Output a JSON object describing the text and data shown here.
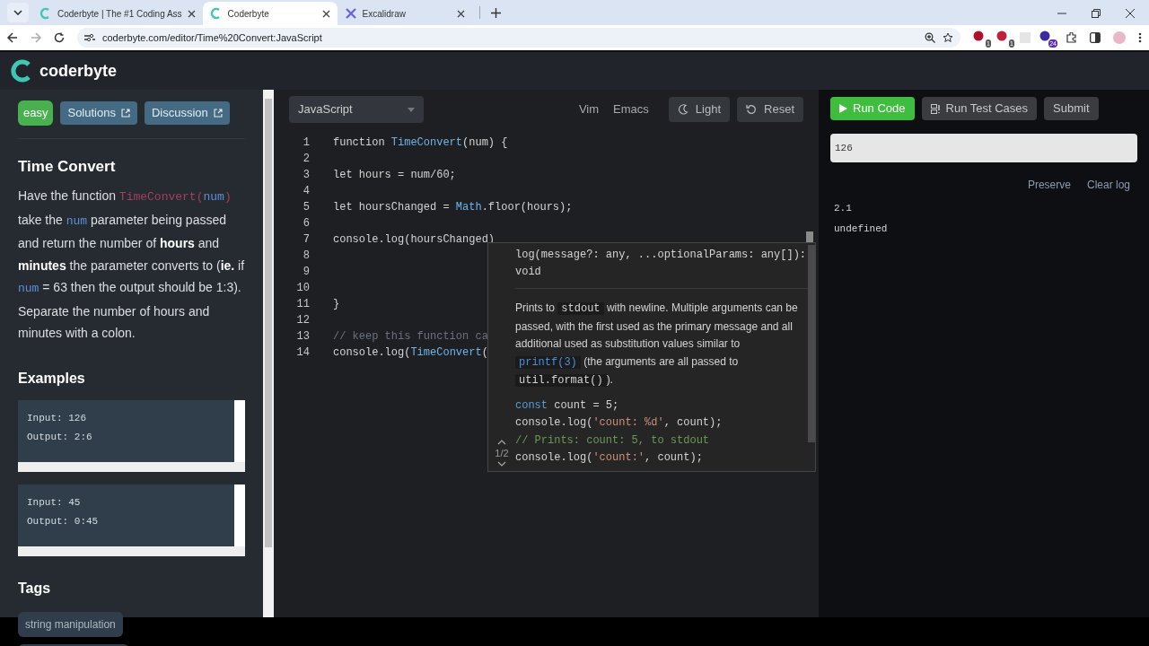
{
  "browser": {
    "tabs": [
      {
        "title": "Coderbyte | The #1 Coding Ass",
        "selected": false
      },
      {
        "title": "Coderbyte",
        "selected": true
      },
      {
        "title": "Excalidraw",
        "selected": false
      }
    ],
    "address": "coderbyte.com/editor/Time%20Convert:JavaScript",
    "extension_badges": [
      "1",
      "1",
      "24"
    ]
  },
  "header": {
    "logo": "coderbyte"
  },
  "problem": {
    "difficulty": "easy",
    "links": [
      "Solutions",
      "Discussion"
    ],
    "title": "Time Convert",
    "description": [
      {
        "kind": "text",
        "text": "Have the function "
      },
      {
        "kind": "code_fn",
        "text": "TimeConvert"
      },
      {
        "kind": "code_punct",
        "text": "("
      },
      {
        "kind": "code",
        "text": "num"
      },
      {
        "kind": "code_punct",
        "text": ")"
      },
      {
        "kind": "text",
        "text": " take the "
      },
      {
        "kind": "code",
        "text": "num"
      },
      {
        "kind": "text",
        "text": " parameter being passed and return the number of "
      },
      {
        "kind": "bold",
        "text": "hours"
      },
      {
        "kind": "text",
        "text": " and "
      },
      {
        "kind": "bold",
        "text": "minutes"
      },
      {
        "kind": "text",
        "text": " the parameter converts to ("
      },
      {
        "kind": "bold",
        "text": "ie."
      },
      {
        "kind": "text",
        "text": " if "
      },
      {
        "kind": "code",
        "text": "num"
      },
      {
        "kind": "text",
        "text": " = 63 then the output should be 1:3). Separate the number of hours and minutes with a colon."
      }
    ],
    "examples_heading": "Examples",
    "examples": [
      {
        "lines": [
          "Input: 126",
          "Output: 2:6"
        ]
      },
      {
        "lines": [
          "Input: 45",
          "Output: 0:45"
        ]
      }
    ],
    "tags_heading": "Tags",
    "tags": [
      "string manipulation"
    ]
  },
  "editor": {
    "language": "JavaScript",
    "modes": [
      "Vim",
      "Emacs"
    ],
    "buttons": [
      {
        "kind": "theme",
        "label": "Light"
      },
      {
        "kind": "reset",
        "label": "Reset"
      }
    ],
    "lines": [
      {
        "number": "1",
        "tokens": [
          {
            "kind": "plain",
            "text": "function "
          },
          {
            "kind": "fn",
            "text": "TimeConvert"
          },
          {
            "kind": "plain",
            "text": "(num) {"
          }
        ]
      },
      {
        "number": "2"
      },
      {
        "number": "3",
        "tokens": [
          {
            "kind": "plain",
            "text": "let hours = num/60;"
          }
        ]
      },
      {
        "number": "4"
      },
      {
        "number": "5",
        "tokens": [
          {
            "kind": "plain",
            "text": "let hoursChanged = "
          },
          {
            "kind": "fn",
            "text": "Math"
          },
          {
            "kind": "plain",
            "text": ".floor(hours);"
          }
        ]
      },
      {
        "number": "6"
      },
      {
        "number": "7",
        "tokens": [
          {
            "kind": "plain",
            "text": "console.log(hoursChanged)"
          }
        ]
      },
      {
        "number": "8"
      },
      {
        "number": "9"
      },
      {
        "number": "10"
      },
      {
        "number": "11",
        "tokens": [
          {
            "kind": "plain",
            "text": "}"
          }
        ]
      },
      {
        "number": "12"
      },
      {
        "number": "13",
        "tokens": [
          {
            "kind": "comment",
            "text": "// keep this function ca"
          }
        ]
      },
      {
        "number": "14",
        "tokens": [
          {
            "kind": "plain",
            "text": "console.log("
          },
          {
            "kind": "fn",
            "text": "TimeConvert"
          },
          {
            "kind": "plain",
            "text": "("
          }
        ]
      }
    ],
    "hover": {
      "signature": "log(message?: any, ...optionalParams: any[]): void",
      "description": [
        {
          "kind": "text",
          "text": "Prints to "
        },
        {
          "kind": "code",
          "text": "stdout"
        },
        {
          "kind": "text",
          "text": " with newline. Multiple arguments can be passed, with the first used as the primary message and all additional used as substitution values similar to "
        },
        {
          "kind": "link",
          "text": "printf(3)"
        },
        {
          "kind": "text",
          "text": " (the arguments are all passed to "
        },
        {
          "kind": "code",
          "text": "util.format()"
        },
        {
          "kind": "text",
          "text": ")."
        }
      ],
      "example": [
        [
          {
            "kind": "keyword",
            "text": "const"
          },
          {
            "kind": "plain",
            "text": " count = 5;"
          }
        ],
        [
          {
            "kind": "plain",
            "text": "console.log("
          },
          {
            "kind": "string",
            "text": "'count: %d'"
          },
          {
            "kind": "plain",
            "text": ", count);"
          }
        ],
        [
          {
            "kind": "comment",
            "text": "// Prints: count: 5, to stdout"
          }
        ],
        [
          {
            "kind": "plain",
            "text": "console.log("
          },
          {
            "kind": "string",
            "text": "'count:'"
          },
          {
            "kind": "plain",
            "text": ", count);"
          }
        ]
      ],
      "pager": "1/2"
    }
  },
  "console": {
    "buttons": [
      {
        "kind": "run",
        "label": "Run Code"
      },
      {
        "kind": "tests",
        "label": "Run Test Cases"
      },
      {
        "kind": "submit",
        "label": "Submit"
      }
    ],
    "input": "126",
    "actions": [
      "Preserve",
      "Clear log"
    ],
    "output": [
      "2.1",
      "undefined"
    ]
  }
}
